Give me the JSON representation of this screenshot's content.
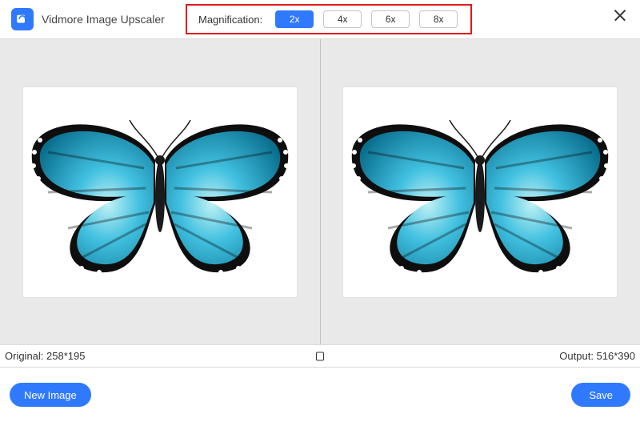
{
  "app": {
    "title": "Vidmore Image Upscaler"
  },
  "magnification": {
    "label": "Magnification:",
    "options": [
      {
        "label": "2x",
        "selected": true
      },
      {
        "label": "4x",
        "selected": false
      },
      {
        "label": "6x",
        "selected": false
      },
      {
        "label": "8x",
        "selected": false
      }
    ]
  },
  "info": {
    "original_label": "Original: 258*195",
    "output_label": "Output: 516*390"
  },
  "footer": {
    "new_image_label": "New Image",
    "save_label": "Save"
  },
  "colors": {
    "accent": "#2f79ff",
    "highlight_border": "#e01a1a"
  }
}
